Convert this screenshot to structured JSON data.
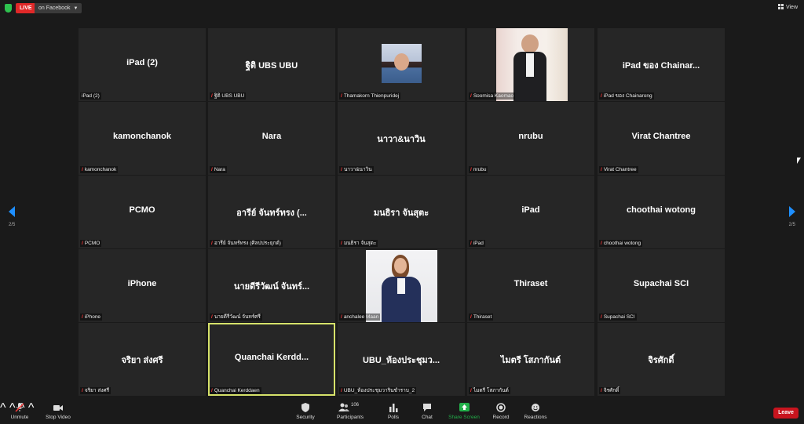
{
  "top_bar": {
    "live_badge": "LIVE",
    "stream_target": "on Facebook",
    "view_label": "View"
  },
  "navigation": {
    "page_left": "2/5",
    "page_right": "2/5"
  },
  "tiles": [
    {
      "display": "iPad (2)",
      "name": "iPad (2)",
      "muted": false
    },
    {
      "display": "ฐิติ UBS UBU",
      "name": "ฐิติ UBS UBU",
      "muted": true
    },
    {
      "display": "",
      "name": "Thamakorn Thienpuridej",
      "muted": true
    },
    {
      "display": "",
      "name": "Soomisa Kaomao",
      "muted": true
    },
    {
      "display": "iPad ของ Chainar...",
      "name": "iPad ของ Chainarong",
      "muted": true
    },
    {
      "display": "kamonchanok",
      "name": "kamonchanok",
      "muted": true
    },
    {
      "display": "Nara",
      "name": "Nara",
      "muted": true
    },
    {
      "display": "นาวา&นาวิน",
      "name": "นาวา&นาวิน",
      "muted": true
    },
    {
      "display": "nrubu",
      "name": "nrubu",
      "muted": true
    },
    {
      "display": "Virat Chantree",
      "name": "Virat Chantree",
      "muted": true
    },
    {
      "display": "PCMO",
      "name": "PCMO",
      "muted": true
    },
    {
      "display": "อารีย์ จันทร์ทรง (...",
      "name": "อารีย์ จันทร์ทรง (ศิลปประยุกต์)",
      "muted": true
    },
    {
      "display": "มนธิรา  จันสุตะ",
      "name": "มนธิรา  จันสุตะ",
      "muted": true
    },
    {
      "display": "iPad",
      "name": "iPad",
      "muted": true
    },
    {
      "display": "choothai wotong",
      "name": "choothai wotong",
      "muted": true
    },
    {
      "display": "iPhone",
      "name": "iPhone",
      "muted": true
    },
    {
      "display": "นายดีรีวัฒน์ จันทร์...",
      "name": "นายดีรีวัฒน์ จันทร์ศรี",
      "muted": true
    },
    {
      "display": "",
      "name": "anchalee Maan",
      "muted": true
    },
    {
      "display": "Thiraset",
      "name": "Thiraset",
      "muted": true
    },
    {
      "display": "Supachai SCI",
      "name": "Supachai SCI",
      "muted": true
    },
    {
      "display": "จริยา ส่งศรี",
      "name": "จริยา ส่งศรี",
      "muted": true
    },
    {
      "display": "Quanchai  Kerdd...",
      "name": "Quanchai Kerddaen",
      "muted": true
    },
    {
      "display": "UBU_ห้องประชุมว...",
      "name": "UBU_ห้องประชุมวารินชำราบ_2",
      "muted": true
    },
    {
      "display": "ไมตรี โสภากันต์",
      "name": "ไมตรี โสภากันต์",
      "muted": true
    },
    {
      "display": "จิรศักดิ์",
      "name": "จิรศักดิ์",
      "muted": true
    }
  ],
  "toolbar": {
    "unmute": "Unmute",
    "stop_video": "Stop Video",
    "security": "Security",
    "participants": "Participants",
    "participant_count": "106",
    "polls": "Polls",
    "chat": "Chat",
    "share_screen": "Share Screen",
    "record": "Record",
    "reactions": "Reactions",
    "leave": "Leave"
  },
  "colors": {
    "background": "#1a1a1a",
    "tile": "#262626",
    "live": "#e02828",
    "active_speaker": "#d6e26a",
    "share_screen": "#22b04a",
    "leave": "#c8141e",
    "nav_arrow": "#1e8fff"
  }
}
